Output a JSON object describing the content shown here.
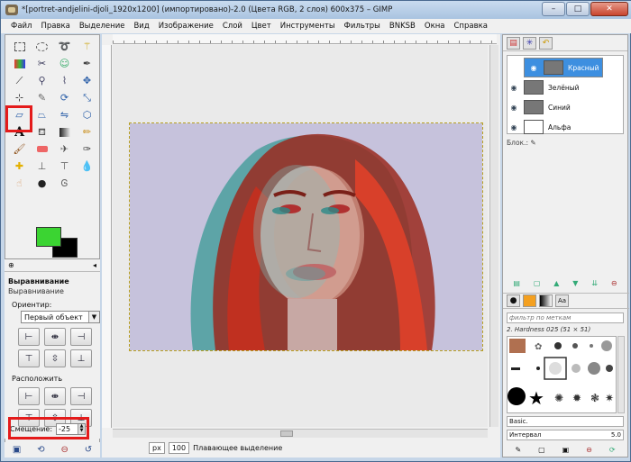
{
  "window": {
    "title": "*[portret-andjelini-djoli_1920x1200] (импортировано)-2.0 (Цвета RGB, 2 слоя) 600x375 – GIMP",
    "minimize": "–",
    "maximize": "□",
    "close": "✕"
  },
  "menu": [
    "Файл",
    "Правка",
    "Выделение",
    "Вид",
    "Изображение",
    "Слой",
    "Цвет",
    "Инструменты",
    "Фильтры",
    "BNKSB",
    "Окна",
    "Справка"
  ],
  "colors": {
    "foreground": "#3bd432",
    "background": "#000000",
    "highlight": "#e41b1b",
    "selected_layer": "#3d8fe0"
  },
  "tool_options": {
    "tab_icon": "⊕",
    "title": "Выравнивание",
    "subtitle": "Выравнивание",
    "relative_label": "Ориентир:",
    "relative_value": "Первый объект",
    "distribute_label": "Расположить",
    "offset_label": "Смещение:",
    "offset_value": "-25"
  },
  "status": {
    "unit": "px",
    "zoom": "100",
    "message": "Плавающее выделение"
  },
  "layers": [
    {
      "name": "Красный",
      "selected": true
    },
    {
      "name": "Зелёный",
      "selected": false
    },
    {
      "name": "Синий",
      "selected": false
    },
    {
      "name": "Альфа",
      "selected": false
    }
  ],
  "lock_label": "Блок.:",
  "brushes": {
    "filter_placeholder": "фильтр по меткам",
    "current": "2. Hardness 025 (51 × 51)",
    "preset": "Basic.",
    "spacing_label": "Интервал",
    "spacing_value": "5.0"
  }
}
